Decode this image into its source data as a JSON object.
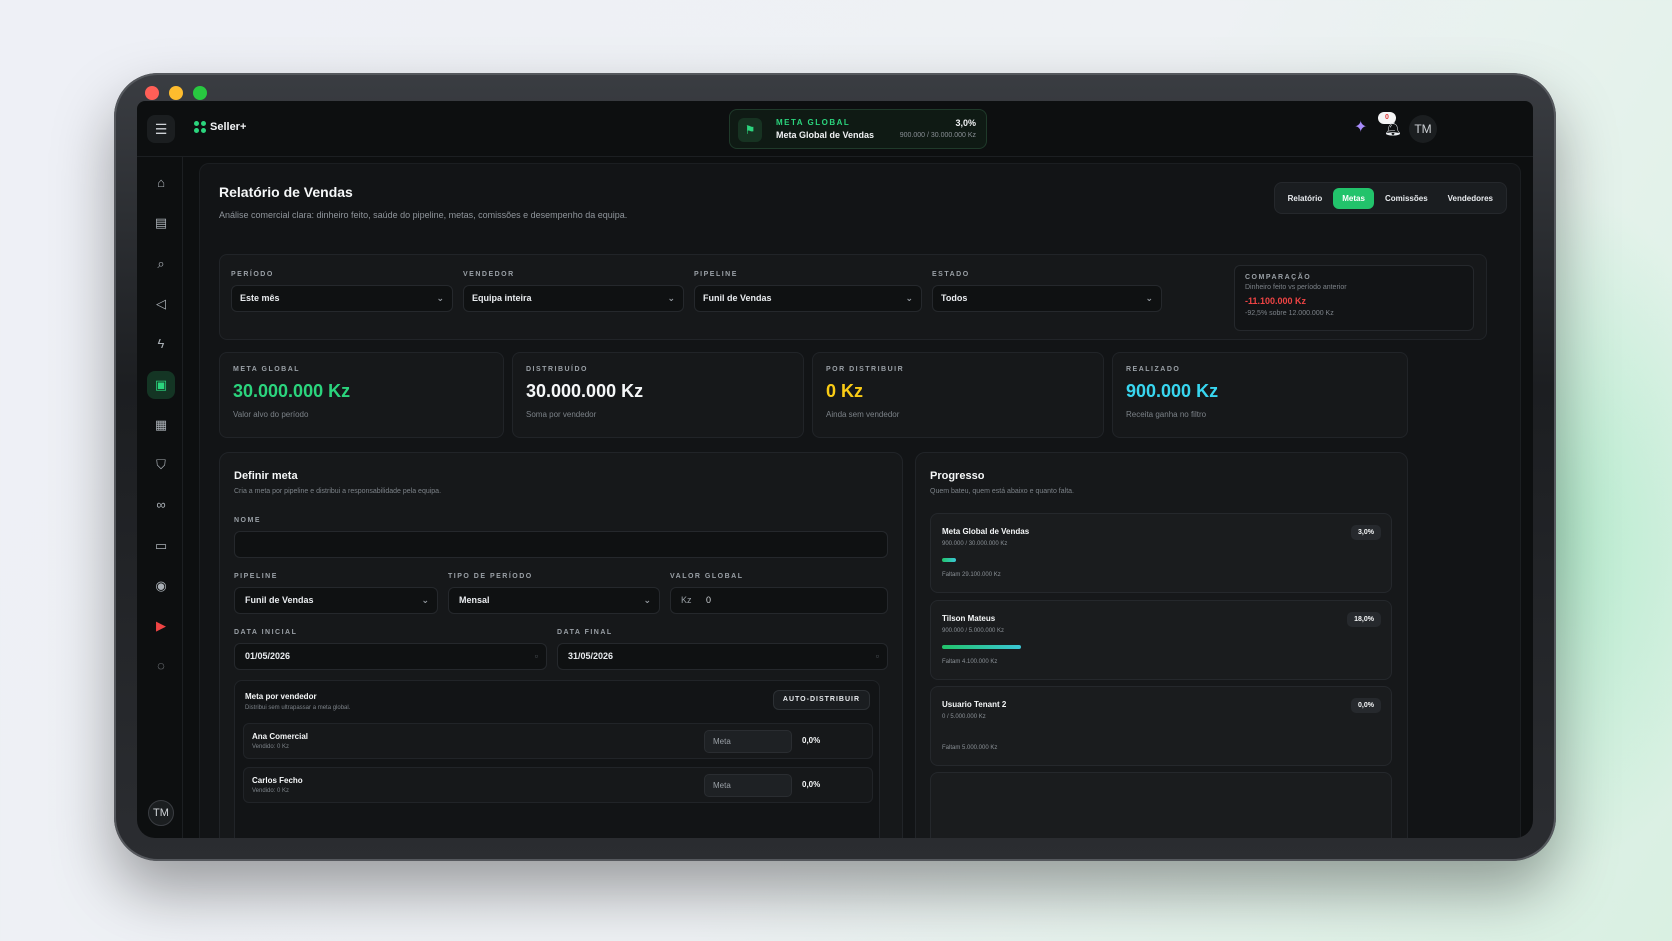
{
  "app": {
    "name": "Seller+"
  },
  "topbar": {
    "meta_label": "META GLOBAL",
    "meta_name": "Meta Global de Vendas",
    "meta_percent": "3,0%",
    "meta_values": "900.000 / 30.000.000 Kz",
    "notification_count": "0",
    "user_initials": "TM"
  },
  "page": {
    "title": "Relatório de Vendas",
    "subtitle": "Análise comercial clara: dinheiro feito, saúde do pipeline, metas, comissões e desempenho da equipa."
  },
  "tabs": [
    {
      "label": "Relatório",
      "active": false
    },
    {
      "label": "Metas",
      "active": true
    },
    {
      "label": "Comissões",
      "active": false
    },
    {
      "label": "Vendedores",
      "active": false
    }
  ],
  "filters": {
    "periodo": {
      "label": "PERÍODO",
      "value": "Este mês"
    },
    "vendedor": {
      "label": "VENDEDOR",
      "value": "Equipa inteira"
    },
    "pipeline": {
      "label": "PIPELINE",
      "value": "Funil de Vendas"
    },
    "estado": {
      "label": "ESTADO",
      "value": "Todos"
    }
  },
  "comparison": {
    "title": "COMPARAÇÃO",
    "subtitle": "Dinheiro feito vs período anterior",
    "value": "-11.100.000 Kz",
    "percent": "-92,5% sobre 12.000.000 Kz"
  },
  "stats": [
    {
      "title": "META GLOBAL",
      "value": "30.000.000 Kz",
      "sub": "Valor alvo do período",
      "color": "#2bd47d"
    },
    {
      "title": "DISTRIBUÍDO",
      "value": "30.000.000 Kz",
      "sub": "Soma por vendedor",
      "color": "#f5f7f8"
    },
    {
      "title": "POR DISTRIBUIR",
      "value": "0 Kz",
      "sub": "Ainda sem vendedor",
      "color": "#facc15"
    },
    {
      "title": "REALIZADO",
      "value": "900.000 Kz",
      "sub": "Receita ganha no filtro",
      "color": "#38d6f0"
    }
  ],
  "define": {
    "title": "Definir meta",
    "subtitle": "Cria a meta por pipeline e distribui a responsabilidade pela equipa.",
    "nome_label": "NOME",
    "nome_value": "",
    "pipeline_label": "PIPELINE",
    "pipeline_value": "Funil de Vendas",
    "tipo_label": "TIPO DE PERÍODO",
    "tipo_value": "Mensal",
    "valor_label": "VALOR GLOBAL",
    "valor_currency": "Kz",
    "valor_value": "0",
    "data_inicial_label": "DATA INICIAL",
    "data_inicial_value": "01/05/2026",
    "data_final_label": "DATA FINAL",
    "data_final_value": "31/05/2026",
    "per_seller_title": "Meta por vendedor",
    "per_seller_sub": "Distribui sem ultrapassar a meta global.",
    "auto_label": "AUTO-DISTRIBUIR",
    "sellers": [
      {
        "name": "Ana Comercial",
        "sold": "Vendido: 0 Kz",
        "placeholder": "Meta",
        "percent": "0,0%"
      },
      {
        "name": "Carlos Fecho",
        "sold": "Vendido: 0 Kz",
        "placeholder": "Meta",
        "percent": "0,0%"
      }
    ]
  },
  "progress": {
    "title": "Progresso",
    "subtitle": "Quem bateu, quem está abaixo e quanto falta.",
    "items": [
      {
        "name": "Meta Global de Vendas",
        "values": "900.000 / 30.000.000 Kz",
        "percent": "3,0%",
        "fraction": 0.03,
        "missing": "Faltam 29.100.000 Kz"
      },
      {
        "name": "Tilson Mateus",
        "values": "900.000 / 5.000.000 Kz",
        "percent": "18,0%",
        "fraction": 0.18,
        "missing": "Faltam 4.100.000 Kz"
      },
      {
        "name": "Usuario Tenant 2",
        "values": "0 / 5.000.000 Kz",
        "percent": "0,0%",
        "fraction": 0.0,
        "missing": "Faltam 5.000.000 Kz"
      }
    ]
  },
  "colors": {
    "accent": "#22c36b",
    "danger": "#ef4444",
    "background": "#0d0f10"
  }
}
